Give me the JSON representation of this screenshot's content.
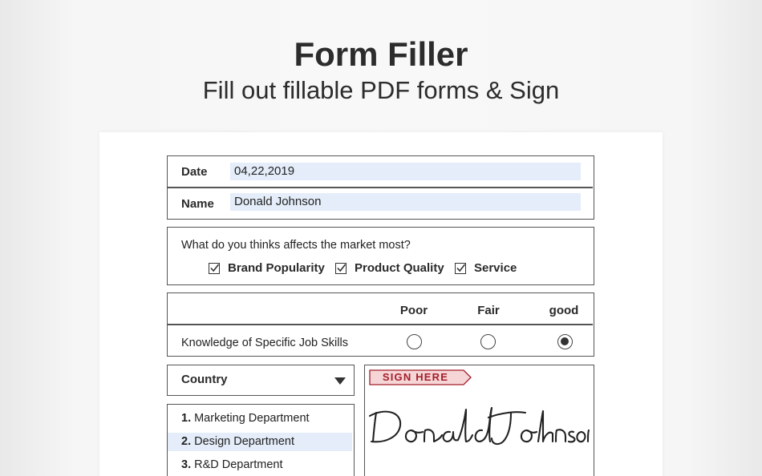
{
  "hero": {
    "title": "Form Filler",
    "subtitle": "Fill out fillable PDF forms & Sign"
  },
  "form": {
    "date_label": "Date",
    "date_value": "04,22,2019",
    "name_label": "Name",
    "name_value": "Donald Johnson",
    "question": "What do you thinks affects the market most?",
    "checkboxes": [
      {
        "label": "Brand Popularity",
        "checked": true
      },
      {
        "label": "Product Quality",
        "checked": true
      },
      {
        "label": "Service",
        "checked": true
      }
    ],
    "rating": {
      "columns": [
        "Poor",
        "Fair",
        "good"
      ],
      "row_label": "Knowledge of Specific Job Skills",
      "selected": "good"
    },
    "dropdown": {
      "selected": "Country",
      "icon": "caret-down-icon"
    },
    "departments": [
      {
        "num": "1.",
        "label": "Marketing Department",
        "selected": false
      },
      {
        "num": "2.",
        "label": "Design Department",
        "selected": true
      },
      {
        "num": "3.",
        "label": "R&D Department",
        "selected": false
      }
    ],
    "signature": {
      "tag": "SIGN HERE",
      "name": "Donald Johnson"
    }
  },
  "colors": {
    "field_fill": "#e4edf9",
    "sign_tag_fill": "#f6d5d6",
    "sign_tag_text": "#a41d2a",
    "border": "#555555"
  }
}
